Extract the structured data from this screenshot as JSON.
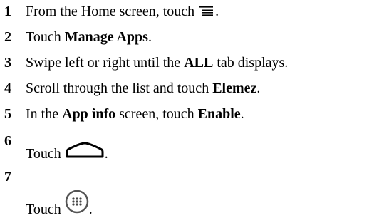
{
  "steps": [
    {
      "number": "1",
      "parts": [
        {
          "t": "text",
          "v": "From the Home screen, touch "
        },
        {
          "t": "icon",
          "icon": "menu-icon"
        },
        {
          "t": "text",
          "v": "."
        }
      ]
    },
    {
      "number": "2",
      "parts": [
        {
          "t": "text",
          "v": "Touch "
        },
        {
          "t": "bold",
          "v": "Manage Apps"
        },
        {
          "t": "text",
          "v": "."
        }
      ]
    },
    {
      "number": "3",
      "parts": [
        {
          "t": "text",
          "v": "Swipe left or right until the "
        },
        {
          "t": "bold",
          "v": "ALL"
        },
        {
          "t": "text",
          "v": " tab displays."
        }
      ]
    },
    {
      "number": "4",
      "parts": [
        {
          "t": "text",
          "v": "Scroll through the list and touch "
        },
        {
          "t": "bold",
          "v": "Elemez"
        },
        {
          "t": "text",
          "v": "."
        }
      ]
    },
    {
      "number": "5",
      "parts": [
        {
          "t": "text",
          "v": "In the "
        },
        {
          "t": "bold",
          "v": "App info"
        },
        {
          "t": "text",
          "v": " screen, touch "
        },
        {
          "t": "bold",
          "v": "Enable"
        },
        {
          "t": "text",
          "v": "."
        }
      ]
    },
    {
      "number": "6",
      "parts": [
        {
          "t": "text",
          "v": "Touch "
        },
        {
          "t": "icon",
          "icon": "home-icon"
        },
        {
          "t": "text",
          "v": "."
        }
      ]
    },
    {
      "number": "7",
      "parts": [
        {
          "t": "text",
          "v": "Touch "
        },
        {
          "t": "icon",
          "icon": "apps-icon"
        },
        {
          "t": "text",
          "v": "."
        }
      ]
    }
  ]
}
